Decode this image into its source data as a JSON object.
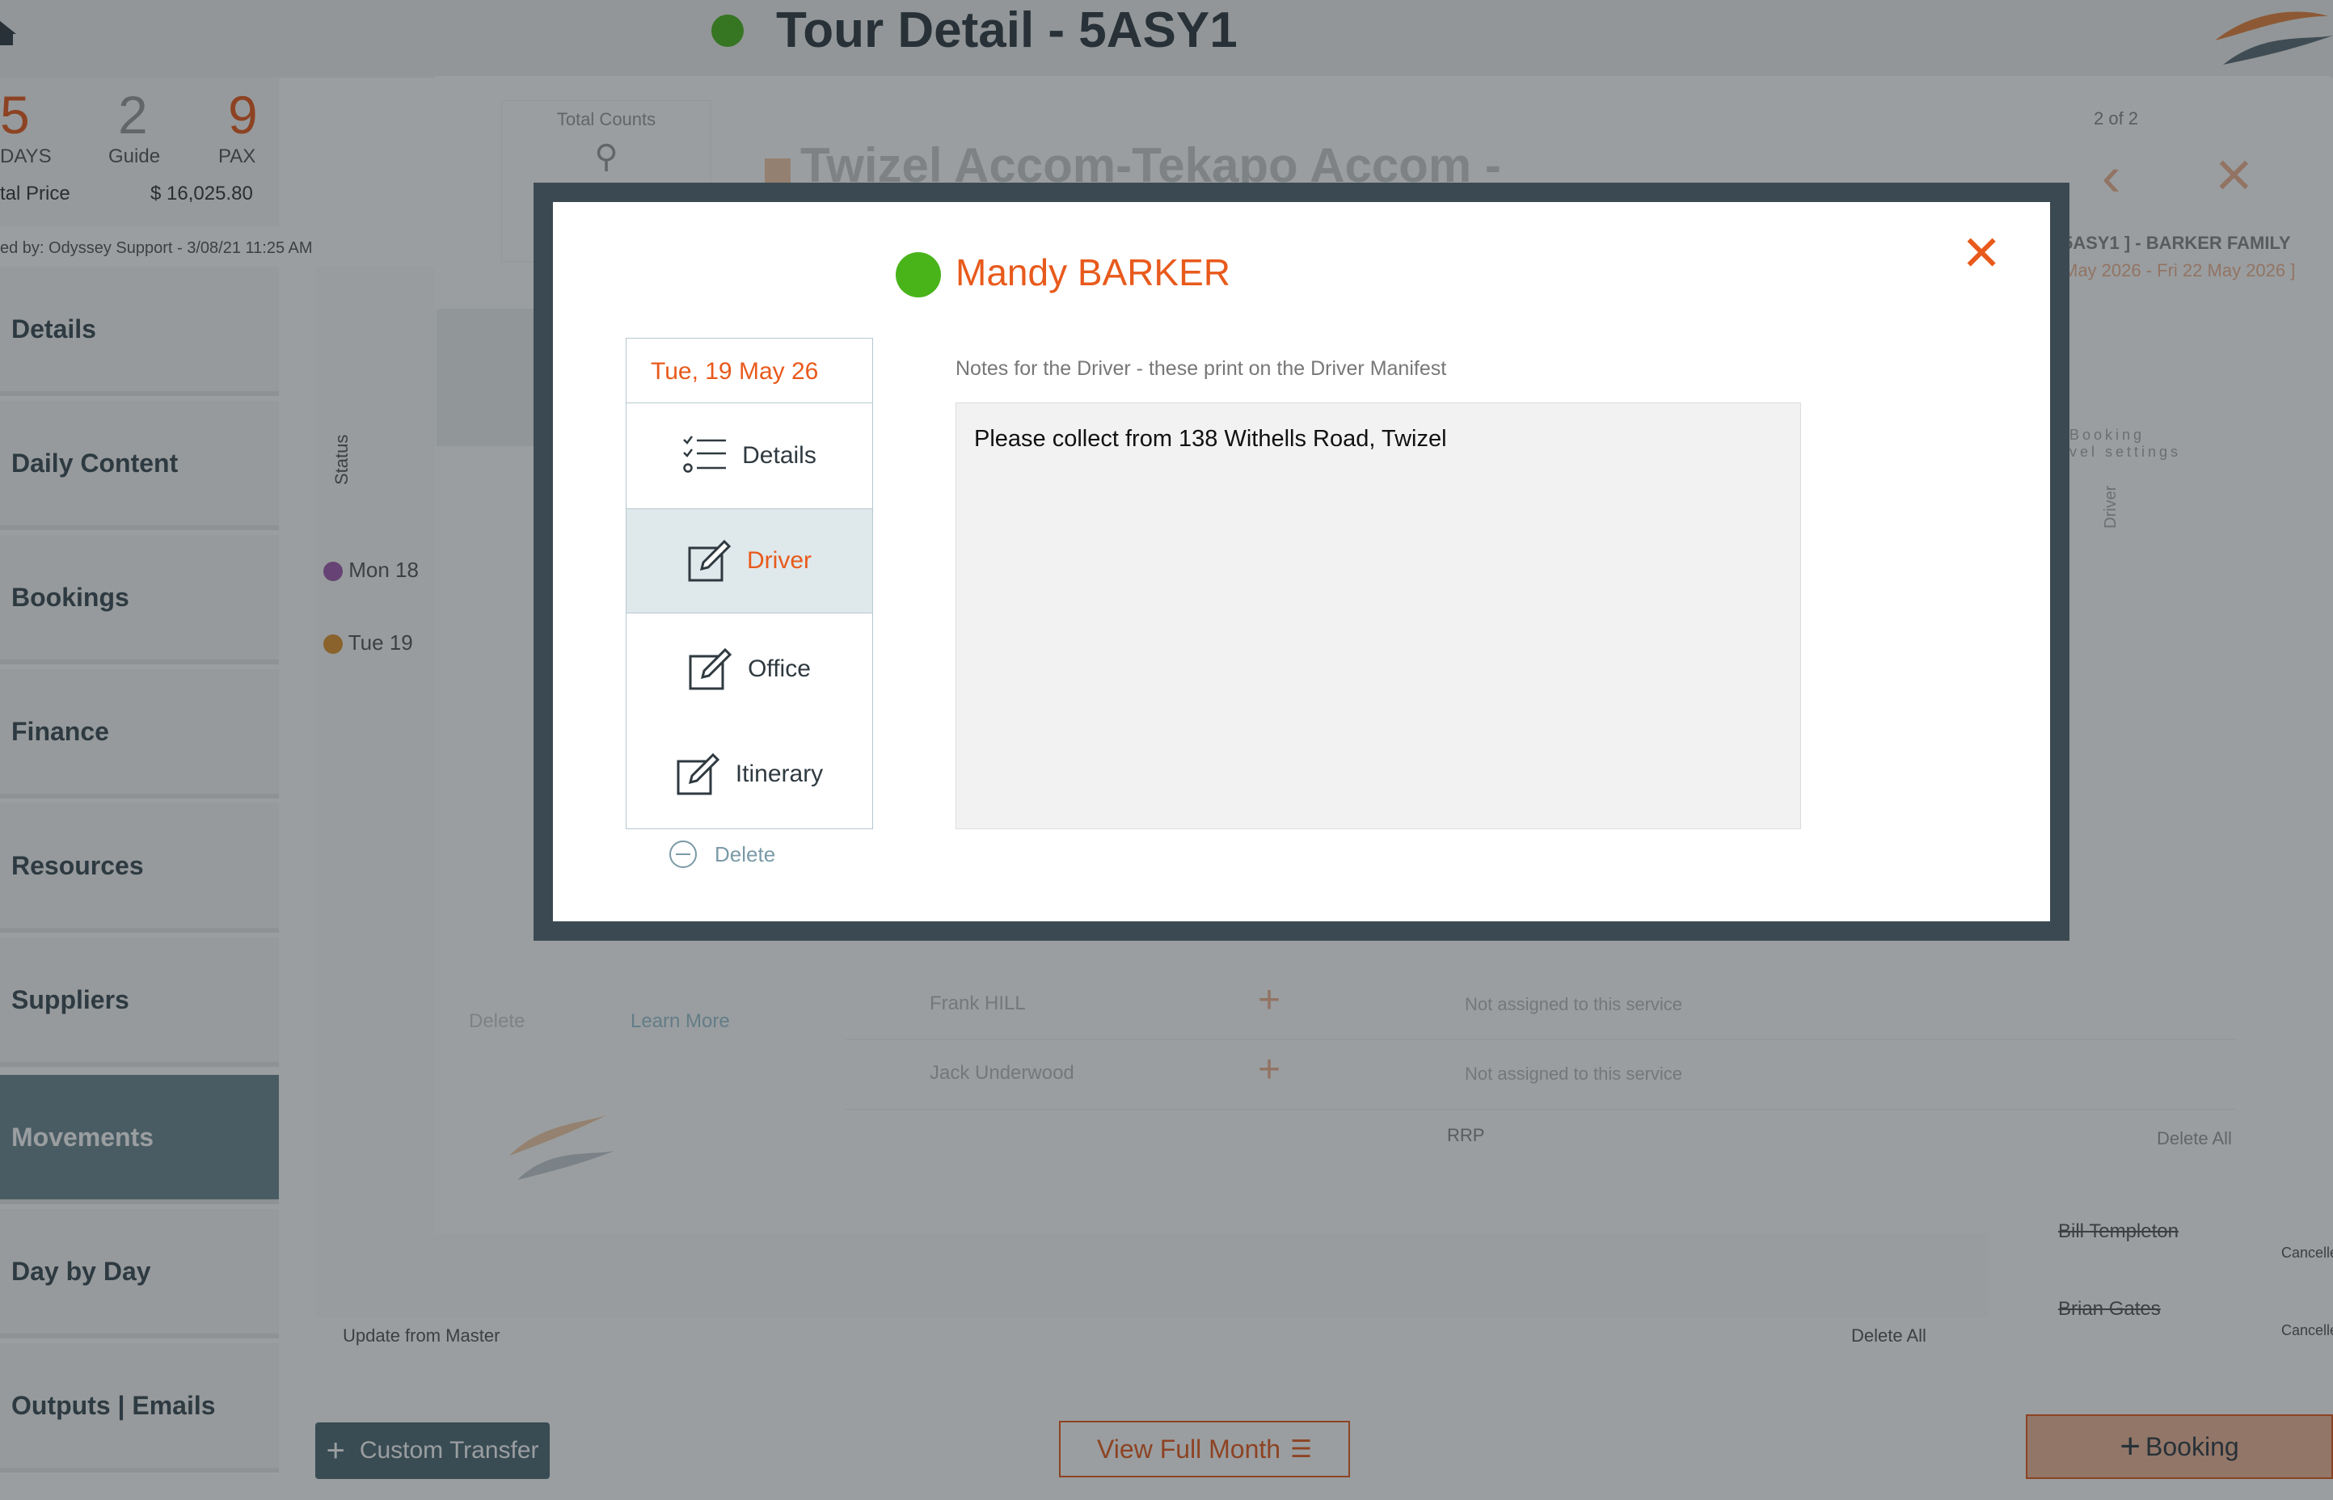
{
  "header": {
    "title": "Tour Detail - 5ASY1"
  },
  "stats": {
    "days_value": "5",
    "days_label": "DAYS",
    "guide_value": "2",
    "guide_label": "Guide",
    "pax_value": "9",
    "pax_label": "PAX",
    "price_label": "tal Price",
    "price_value": "$ 16,025.80",
    "modified": "ed by: Odyssey Support - 3/08/21 11:25 AM"
  },
  "left_nav": {
    "items": [
      {
        "label": "Details"
      },
      {
        "label": "Daily Content"
      },
      {
        "label": "Bookings"
      },
      {
        "label": "Finance"
      },
      {
        "label": "Resources"
      },
      {
        "label": "Suppliers"
      },
      {
        "label": "Movements"
      },
      {
        "label": "Day by Day"
      },
      {
        "label": "Outputs | Emails"
      }
    ]
  },
  "underlay": {
    "status_header": "Status",
    "row1": "Mon 18",
    "row2": "Tue 19",
    "update_master": "Update from Master",
    "delete_all": "Delete All",
    "custom_transfer": "Custom Transfer",
    "view_full_month": "View Full Month",
    "booking": "Booking"
  },
  "outer_modal": {
    "total_counts": "Total Counts",
    "title": "Twizel Accom-Tekapo Accom -",
    "pager": "2 of 2",
    "sub1": "5ASY1 ] - BARKER FAMILY",
    "sub2": "May 2026 - Fri 22 May 2026 ]",
    "booking_settings": "Booking\nvel settings",
    "driver_col": "Driver",
    "delete": "Delete",
    "learn_more": "Learn More",
    "rows": [
      {
        "name": "Frank HILL",
        "status": "Not assigned to this service"
      },
      {
        "name": "Jack Underwood",
        "status": "Not assigned to this service"
      }
    ],
    "rrp": "RRP",
    "delete_all": "Delete All",
    "cancelled": [
      {
        "name": "Bill Templeton",
        "status": "Cancelle"
      },
      {
        "name": "Brian Gates",
        "status": "Cancelle"
      }
    ]
  },
  "inner_modal": {
    "person_name": "Mandy BARKER",
    "date": "Tue, 19 May 26",
    "tabs": [
      {
        "label": "Details"
      },
      {
        "label": "Driver"
      },
      {
        "label": "Office"
      },
      {
        "label": "Itinerary"
      }
    ],
    "delete": "Delete",
    "notes_label": "Notes for the Driver - these print on the Driver Manifest",
    "notes_value": "Please collect from 138 Withells Road, Twizel"
  },
  "colors": {
    "accent": "#e85a1c",
    "status_green": "#49b41a",
    "dark": "#3b4a52"
  }
}
